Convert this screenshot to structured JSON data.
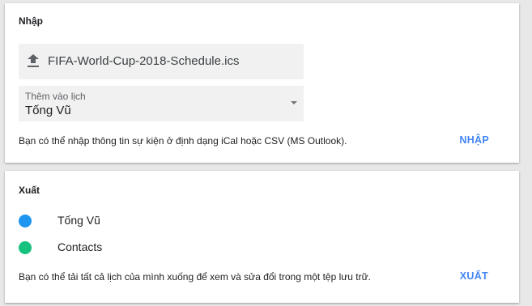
{
  "import": {
    "title": "Nhập",
    "file_name": "FIFA-World-Cup-2018-Schedule.ics",
    "select_label": "Thêm vào lịch",
    "select_value": "Tống Vũ",
    "description": "Bạn có thể nhập thông tin sự kiện ở định dạng iCal hoặc CSV (MS Outlook).",
    "button": "NHẬP"
  },
  "export": {
    "title": "Xuất",
    "calendars": [
      {
        "name": "Tống Vũ",
        "color": "#1e96f0"
      },
      {
        "name": "Contacts",
        "color": "#17c17e"
      }
    ],
    "description": "Bạn có thể tải tất cả lịch của mình xuống để xem và sửa đổi trong một tệp lưu trữ.",
    "button": "XUẤT"
  },
  "icons": {
    "upload": "upload-icon",
    "dropdown": "dropdown-arrow-icon"
  },
  "colors": {
    "accent": "#4285f4"
  }
}
